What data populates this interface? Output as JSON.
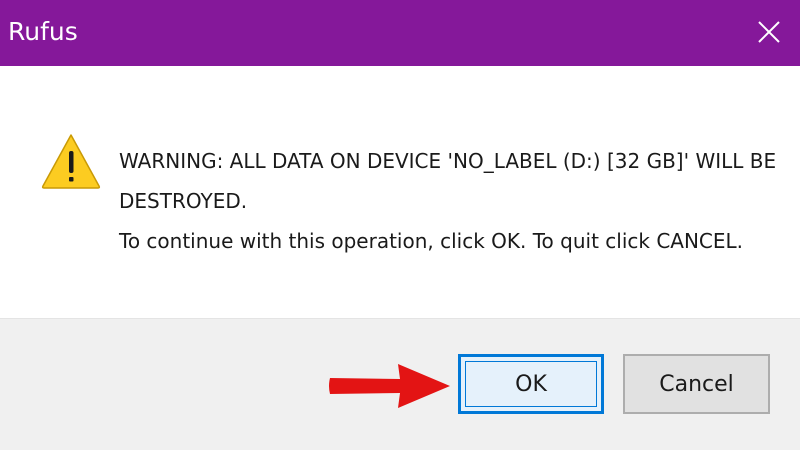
{
  "window": {
    "title": "Rufus",
    "accent_color": "#85189a"
  },
  "titlebar": {
    "close_icon": "close-icon"
  },
  "dialog": {
    "icon": "warning-icon",
    "message_line1": "WARNING: ALL DATA ON DEVICE 'NO_LABEL (D:) [32 GB]' WILL BE",
    "message_line2": "DESTROYED.",
    "message_line3": "To continue with this operation, click OK. To quit click CANCEL."
  },
  "buttons": {
    "ok_label": "OK",
    "cancel_label": "Cancel"
  },
  "annotation": {
    "arrow_icon": "red-arrow-icon",
    "arrow_color": "#e31414"
  }
}
